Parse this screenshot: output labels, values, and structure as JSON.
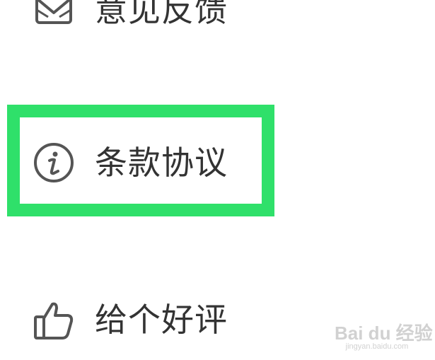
{
  "menu": {
    "items": [
      {
        "label": "意见反馈",
        "icon": "mail-icon"
      },
      {
        "label": "条款协议",
        "icon": "info-icon"
      },
      {
        "label": "给个好评",
        "icon": "thumbs-up-icon"
      }
    ]
  },
  "highlight": {
    "color": "#2fe06a",
    "target": "条款协议"
  },
  "watermark": {
    "logo_text": "Bai du 经验",
    "url_text": "jingyan.baidu.com"
  }
}
